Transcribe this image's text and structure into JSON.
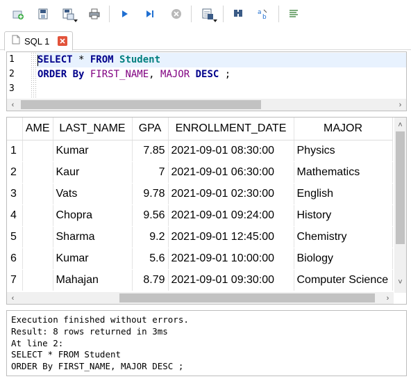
{
  "toolbar": {
    "icons": [
      "open-tab-icon",
      "open-sql-icon",
      "save-sql-icon",
      "print-icon",
      "execute-all-icon",
      "execute-current-icon",
      "stop-icon",
      "save-results-icon",
      "find-icon",
      "find-replace-icon",
      "comment-icon"
    ]
  },
  "tab": {
    "label": "SQL 1"
  },
  "editor": {
    "line_numbers": [
      "1",
      "2",
      "3"
    ],
    "line1": {
      "kw1": "SELECT",
      "star": " * ",
      "kw2": "FROM",
      "table": " Student"
    },
    "line2": {
      "kw1": "ORDER By",
      "col1": " FIRST_NAME",
      "comma": ",",
      "col2": " MAJOR",
      "kw2": " DESC",
      "semi": " ;"
    }
  },
  "grid": {
    "columns": [
      "AME",
      "LAST_NAME",
      "GPA",
      "ENROLLMENT_DATE",
      "MAJOR"
    ],
    "rows": [
      {
        "n": "1",
        "first": "",
        "last": "Kumar",
        "gpa": "7.85",
        "date": "2021-09-01 08:30:00",
        "major": "Physics"
      },
      {
        "n": "2",
        "first": "",
        "last": "Kaur",
        "gpa": "7",
        "date": "2021-09-01 06:30:00",
        "major": "Mathematics"
      },
      {
        "n": "3",
        "first": "",
        "last": "Vats",
        "gpa": "9.78",
        "date": "2021-09-01 02:30:00",
        "major": "English"
      },
      {
        "n": "4",
        "first": "",
        "last": "Chopra",
        "gpa": "9.56",
        "date": "2021-09-01 09:24:00",
        "major": "History"
      },
      {
        "n": "5",
        "first": "",
        "last": "Sharma",
        "gpa": "9.2",
        "date": "2021-09-01 12:45:00",
        "major": "Chemistry"
      },
      {
        "n": "6",
        "first": "",
        "last": "Kumar",
        "gpa": "5.6",
        "date": "2021-09-01 10:00:00",
        "major": "Biology"
      },
      {
        "n": "7",
        "first": "",
        "last": "Mahajan",
        "gpa": "8.79",
        "date": "2021-09-01 09:30:00",
        "major": "Computer Science"
      }
    ]
  },
  "output": {
    "lines": [
      "Execution finished without errors.",
      "Result: 8 rows returned in 3ms",
      "At line 2:",
      "SELECT * FROM Student",
      "ORDER By FIRST_NAME, MAJOR DESC ;"
    ]
  },
  "colors": {
    "keyword": "#00008b",
    "identifier": "#007f7f",
    "column": "#800080",
    "active_line": "#e8f2fe",
    "close": "#e2533b"
  }
}
